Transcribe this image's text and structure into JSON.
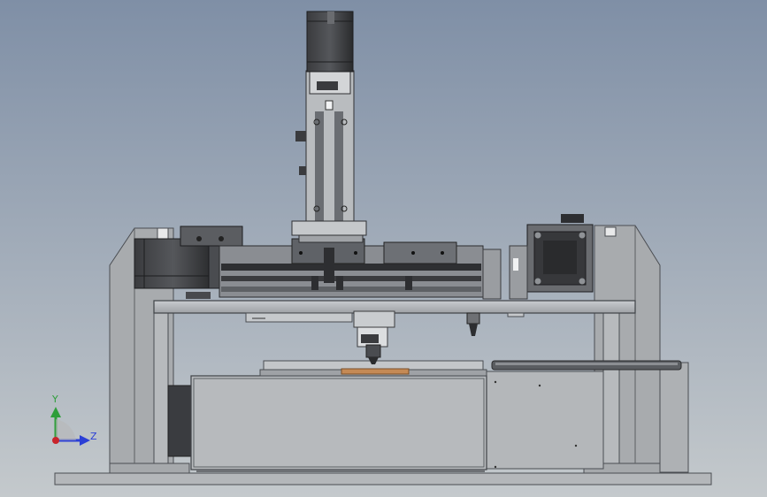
{
  "viewport": {
    "background_top": "#7f8fa6",
    "background_bottom": "#c4c9cc"
  },
  "colors": {
    "frame": "#a6a9ac",
    "frame_edge": "#4a4d52",
    "motor_dark": "#2f3033",
    "rail": "#7d8085",
    "plate": "#b9bcbf",
    "accent_copper": "#c58a55"
  },
  "triad": {
    "y_label": "Y",
    "z_label": "Z",
    "y_color": "#2e9e3a",
    "z_color": "#2b3fd6",
    "x_color": "#c8242b"
  }
}
